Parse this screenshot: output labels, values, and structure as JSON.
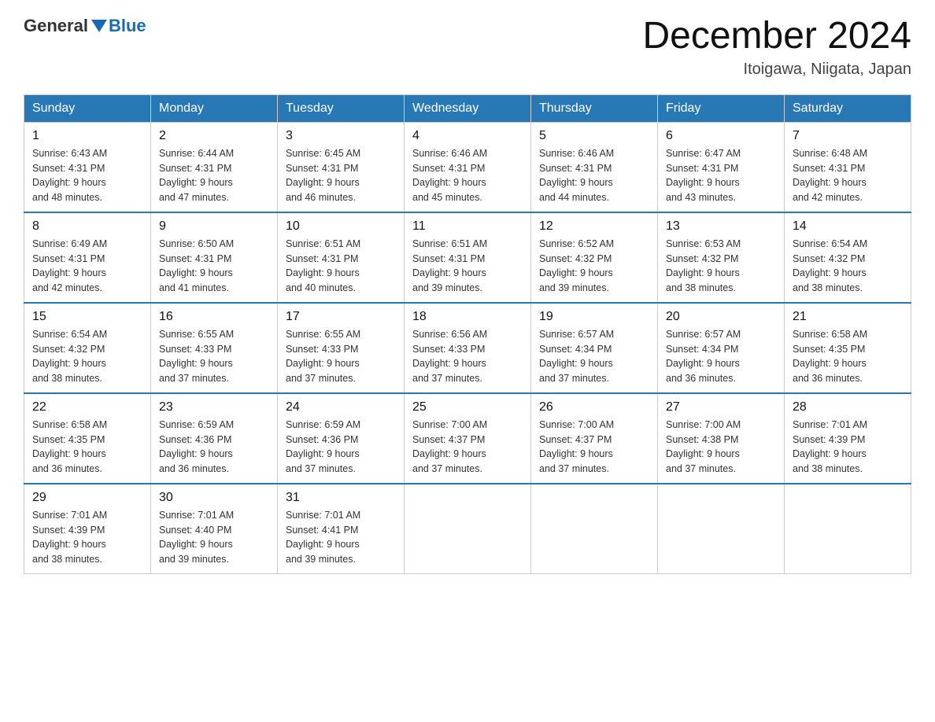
{
  "header": {
    "logo_general": "General",
    "logo_blue": "Blue",
    "month_title": "December 2024",
    "location": "Itoigawa, Niigata, Japan"
  },
  "weekdays": [
    "Sunday",
    "Monday",
    "Tuesday",
    "Wednesday",
    "Thursday",
    "Friday",
    "Saturday"
  ],
  "weeks": [
    [
      {
        "day": "1",
        "sunrise": "6:43 AM",
        "sunset": "4:31 PM",
        "daylight": "9 hours and 48 minutes."
      },
      {
        "day": "2",
        "sunrise": "6:44 AM",
        "sunset": "4:31 PM",
        "daylight": "9 hours and 47 minutes."
      },
      {
        "day": "3",
        "sunrise": "6:45 AM",
        "sunset": "4:31 PM",
        "daylight": "9 hours and 46 minutes."
      },
      {
        "day": "4",
        "sunrise": "6:46 AM",
        "sunset": "4:31 PM",
        "daylight": "9 hours and 45 minutes."
      },
      {
        "day": "5",
        "sunrise": "6:46 AM",
        "sunset": "4:31 PM",
        "daylight": "9 hours and 44 minutes."
      },
      {
        "day": "6",
        "sunrise": "6:47 AM",
        "sunset": "4:31 PM",
        "daylight": "9 hours and 43 minutes."
      },
      {
        "day": "7",
        "sunrise": "6:48 AM",
        "sunset": "4:31 PM",
        "daylight": "9 hours and 42 minutes."
      }
    ],
    [
      {
        "day": "8",
        "sunrise": "6:49 AM",
        "sunset": "4:31 PM",
        "daylight": "9 hours and 42 minutes."
      },
      {
        "day": "9",
        "sunrise": "6:50 AM",
        "sunset": "4:31 PM",
        "daylight": "9 hours and 41 minutes."
      },
      {
        "day": "10",
        "sunrise": "6:51 AM",
        "sunset": "4:31 PM",
        "daylight": "9 hours and 40 minutes."
      },
      {
        "day": "11",
        "sunrise": "6:51 AM",
        "sunset": "4:31 PM",
        "daylight": "9 hours and 39 minutes."
      },
      {
        "day": "12",
        "sunrise": "6:52 AM",
        "sunset": "4:32 PM",
        "daylight": "9 hours and 39 minutes."
      },
      {
        "day": "13",
        "sunrise": "6:53 AM",
        "sunset": "4:32 PM",
        "daylight": "9 hours and 38 minutes."
      },
      {
        "day": "14",
        "sunrise": "6:54 AM",
        "sunset": "4:32 PM",
        "daylight": "9 hours and 38 minutes."
      }
    ],
    [
      {
        "day": "15",
        "sunrise": "6:54 AM",
        "sunset": "4:32 PM",
        "daylight": "9 hours and 38 minutes."
      },
      {
        "day": "16",
        "sunrise": "6:55 AM",
        "sunset": "4:33 PM",
        "daylight": "9 hours and 37 minutes."
      },
      {
        "day": "17",
        "sunrise": "6:55 AM",
        "sunset": "4:33 PM",
        "daylight": "9 hours and 37 minutes."
      },
      {
        "day": "18",
        "sunrise": "6:56 AM",
        "sunset": "4:33 PM",
        "daylight": "9 hours and 37 minutes."
      },
      {
        "day": "19",
        "sunrise": "6:57 AM",
        "sunset": "4:34 PM",
        "daylight": "9 hours and 37 minutes."
      },
      {
        "day": "20",
        "sunrise": "6:57 AM",
        "sunset": "4:34 PM",
        "daylight": "9 hours and 36 minutes."
      },
      {
        "day": "21",
        "sunrise": "6:58 AM",
        "sunset": "4:35 PM",
        "daylight": "9 hours and 36 minutes."
      }
    ],
    [
      {
        "day": "22",
        "sunrise": "6:58 AM",
        "sunset": "4:35 PM",
        "daylight": "9 hours and 36 minutes."
      },
      {
        "day": "23",
        "sunrise": "6:59 AM",
        "sunset": "4:36 PM",
        "daylight": "9 hours and 36 minutes."
      },
      {
        "day": "24",
        "sunrise": "6:59 AM",
        "sunset": "4:36 PM",
        "daylight": "9 hours and 37 minutes."
      },
      {
        "day": "25",
        "sunrise": "7:00 AM",
        "sunset": "4:37 PM",
        "daylight": "9 hours and 37 minutes."
      },
      {
        "day": "26",
        "sunrise": "7:00 AM",
        "sunset": "4:37 PM",
        "daylight": "9 hours and 37 minutes."
      },
      {
        "day": "27",
        "sunrise": "7:00 AM",
        "sunset": "4:38 PM",
        "daylight": "9 hours and 37 minutes."
      },
      {
        "day": "28",
        "sunrise": "7:01 AM",
        "sunset": "4:39 PM",
        "daylight": "9 hours and 38 minutes."
      }
    ],
    [
      {
        "day": "29",
        "sunrise": "7:01 AM",
        "sunset": "4:39 PM",
        "daylight": "9 hours and 38 minutes."
      },
      {
        "day": "30",
        "sunrise": "7:01 AM",
        "sunset": "4:40 PM",
        "daylight": "9 hours and 39 minutes."
      },
      {
        "day": "31",
        "sunrise": "7:01 AM",
        "sunset": "4:41 PM",
        "daylight": "9 hours and 39 minutes."
      },
      null,
      null,
      null,
      null
    ]
  ]
}
